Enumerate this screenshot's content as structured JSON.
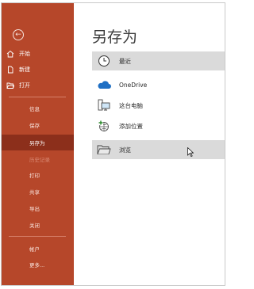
{
  "backstage": {
    "back_icon": "back-arrow-icon",
    "nav_top": [
      {
        "label": "开始",
        "icon": "home-icon"
      },
      {
        "label": "新建",
        "icon": "new-document-icon"
      },
      {
        "label": "打开",
        "icon": "open-folder-icon"
      }
    ],
    "nav_sub": [
      {
        "label": "信息"
      },
      {
        "label": "保存"
      },
      {
        "label": "另存为",
        "selected": true
      },
      {
        "label": "历史记录",
        "disabled": true
      },
      {
        "label": "打印"
      },
      {
        "label": "共享"
      },
      {
        "label": "导出"
      },
      {
        "label": "关闭"
      }
    ],
    "nav_bottom": [
      {
        "label": "帐户"
      },
      {
        "label": "更多..."
      }
    ]
  },
  "main": {
    "title": "另存为",
    "locations": [
      {
        "label": "最近",
        "icon": "clock-icon",
        "highlighted": true
      },
      {
        "label": "OneDrive",
        "icon": "cloud-icon",
        "highlighted": false
      },
      {
        "label": "这台电脑",
        "icon": "computer-icon",
        "highlighted": false
      },
      {
        "label": "添加位置",
        "icon": "globe-add-icon",
        "highlighted": false
      },
      {
        "label": "浏览",
        "icon": "folder-icon",
        "highlighted": true
      }
    ]
  },
  "colors": {
    "backstage_bg": "#b6472a",
    "selected_bg": "#8c2f1b",
    "highlight_bg": "#dadada",
    "onedrive_blue": "#1e6fc4"
  }
}
